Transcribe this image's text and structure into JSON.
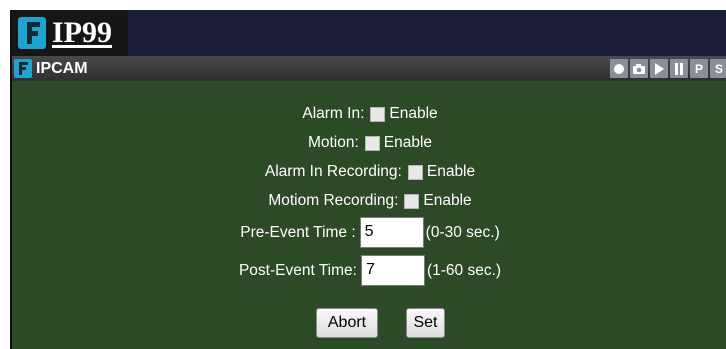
{
  "brand": {
    "name": "IP99",
    "logo_icon": "ip99-logo-icon"
  },
  "camera": {
    "name": "IPCAM",
    "icon": "camera-logo-icon"
  },
  "controls": {
    "record_icon": "record-icon",
    "snapshot_icon": "camera-snapshot-icon",
    "play_icon": "play-icon",
    "pause_icon": "pause-icon",
    "p_label": "P",
    "s_label": "S"
  },
  "form": {
    "alarm_in": {
      "label": "Alarm In:",
      "checkbox_label": "Enable",
      "checked": false
    },
    "motion": {
      "label": "Motion:",
      "checkbox_label": "Enable",
      "checked": false
    },
    "alarm_in_recording": {
      "label": "Alarm In Recording:",
      "checkbox_label": "Enable",
      "checked": false
    },
    "motion_recording": {
      "label": "Motiom Recording:",
      "checkbox_label": "Enable",
      "checked": false
    },
    "pre_event": {
      "label": "Pre-Event Time :",
      "value": "5",
      "range": "(0-30 sec.)"
    },
    "post_event": {
      "label": "Post-Event Time:",
      "value": "7",
      "range": "(1-60 sec.)"
    }
  },
  "buttons": {
    "abort": "Abort",
    "set": "Set"
  },
  "colors": {
    "panel": "#2c4a26",
    "brandbar": "#1d1f3a",
    "accent": "#1fa3cf"
  }
}
